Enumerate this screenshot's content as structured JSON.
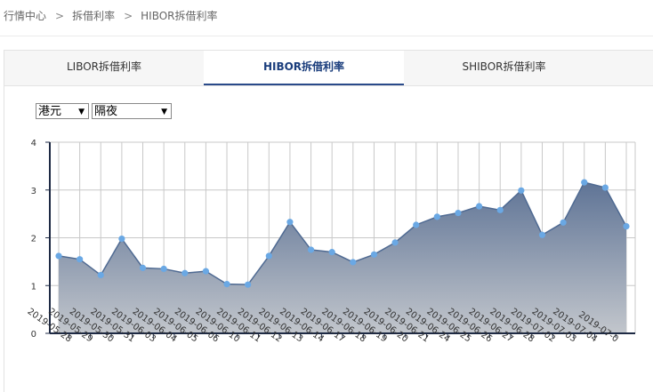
{
  "breadcrumb": {
    "items": [
      "行情中心",
      "拆借利率",
      "HIBOR拆借利率"
    ],
    "separator": ">"
  },
  "tabs": [
    {
      "label": "LIBOR拆借利率",
      "active": false
    },
    {
      "label": "HIBOR拆借利率",
      "active": true
    },
    {
      "label": "SHIBOR拆借利率",
      "active": false
    }
  ],
  "filters": {
    "currency": "港元",
    "term": "隔夜"
  },
  "colors": {
    "accent": "#2a4a8a",
    "area_top": "#5f7496",
    "area_bottom": "#c2c6cc",
    "point": "#6aa8e4"
  },
  "chart_data": {
    "type": "area",
    "x": [
      "2019-05-28",
      "2019-05-29",
      "2019-05-30",
      "2019-05-31",
      "2019-06-03",
      "2019-06-04",
      "2019-06-05",
      "2019-06-06",
      "2019-06-10",
      "2019-06-11",
      "2019-06-12",
      "2019-06-13",
      "2019-06-14",
      "2019-06-17",
      "2019-06-18",
      "2019-06-19",
      "2019-06-20",
      "2019-06-21",
      "2019-06-24",
      "2019-06-25",
      "2019-06-26",
      "2019-06-27",
      "2019-06-28",
      "2019-07-02",
      "2019-07-03",
      "2019-07-04",
      "2019-07-05"
    ],
    "series": [
      {
        "values": [
          1.62,
          1.55,
          1.22,
          1.98,
          1.37,
          1.35,
          1.26,
          1.3,
          1.03,
          1.02,
          1.62,
          2.33,
          1.75,
          1.7,
          1.49,
          1.65,
          1.9,
          2.27,
          2.44,
          2.52,
          2.66,
          2.58,
          2.99,
          2.06,
          2.32,
          3.16,
          3.05,
          2.24
        ]
      }
    ],
    "x_labels_visible": [
      "2019-05-28",
      "2019-05-29",
      "2019-05-30",
      "2019-05-31",
      "2019-06-03",
      "2019-06-04",
      "2019-06-05",
      "2019-06-06",
      "2019-06-10",
      "2019-06-11",
      "2019-06-12",
      "2019-06-13",
      "2019-06-14",
      "2019-06-17",
      "2019-06-18",
      "2019-06-19",
      "2019-06-20",
      "2019-06-21",
      "2019-06-24",
      "2019-06-25",
      "2019-06-26",
      "2019-06-27",
      "2019-06-28",
      "2019-07-02",
      "2019-07-03",
      "2019-07-04",
      "2019-07-0"
    ],
    "yticks": [
      "0",
      "1",
      "2",
      "3",
      "4"
    ],
    "ylim": [
      0,
      4
    ],
    "grid": true,
    "title": "",
    "xlabel": "",
    "ylabel": ""
  }
}
